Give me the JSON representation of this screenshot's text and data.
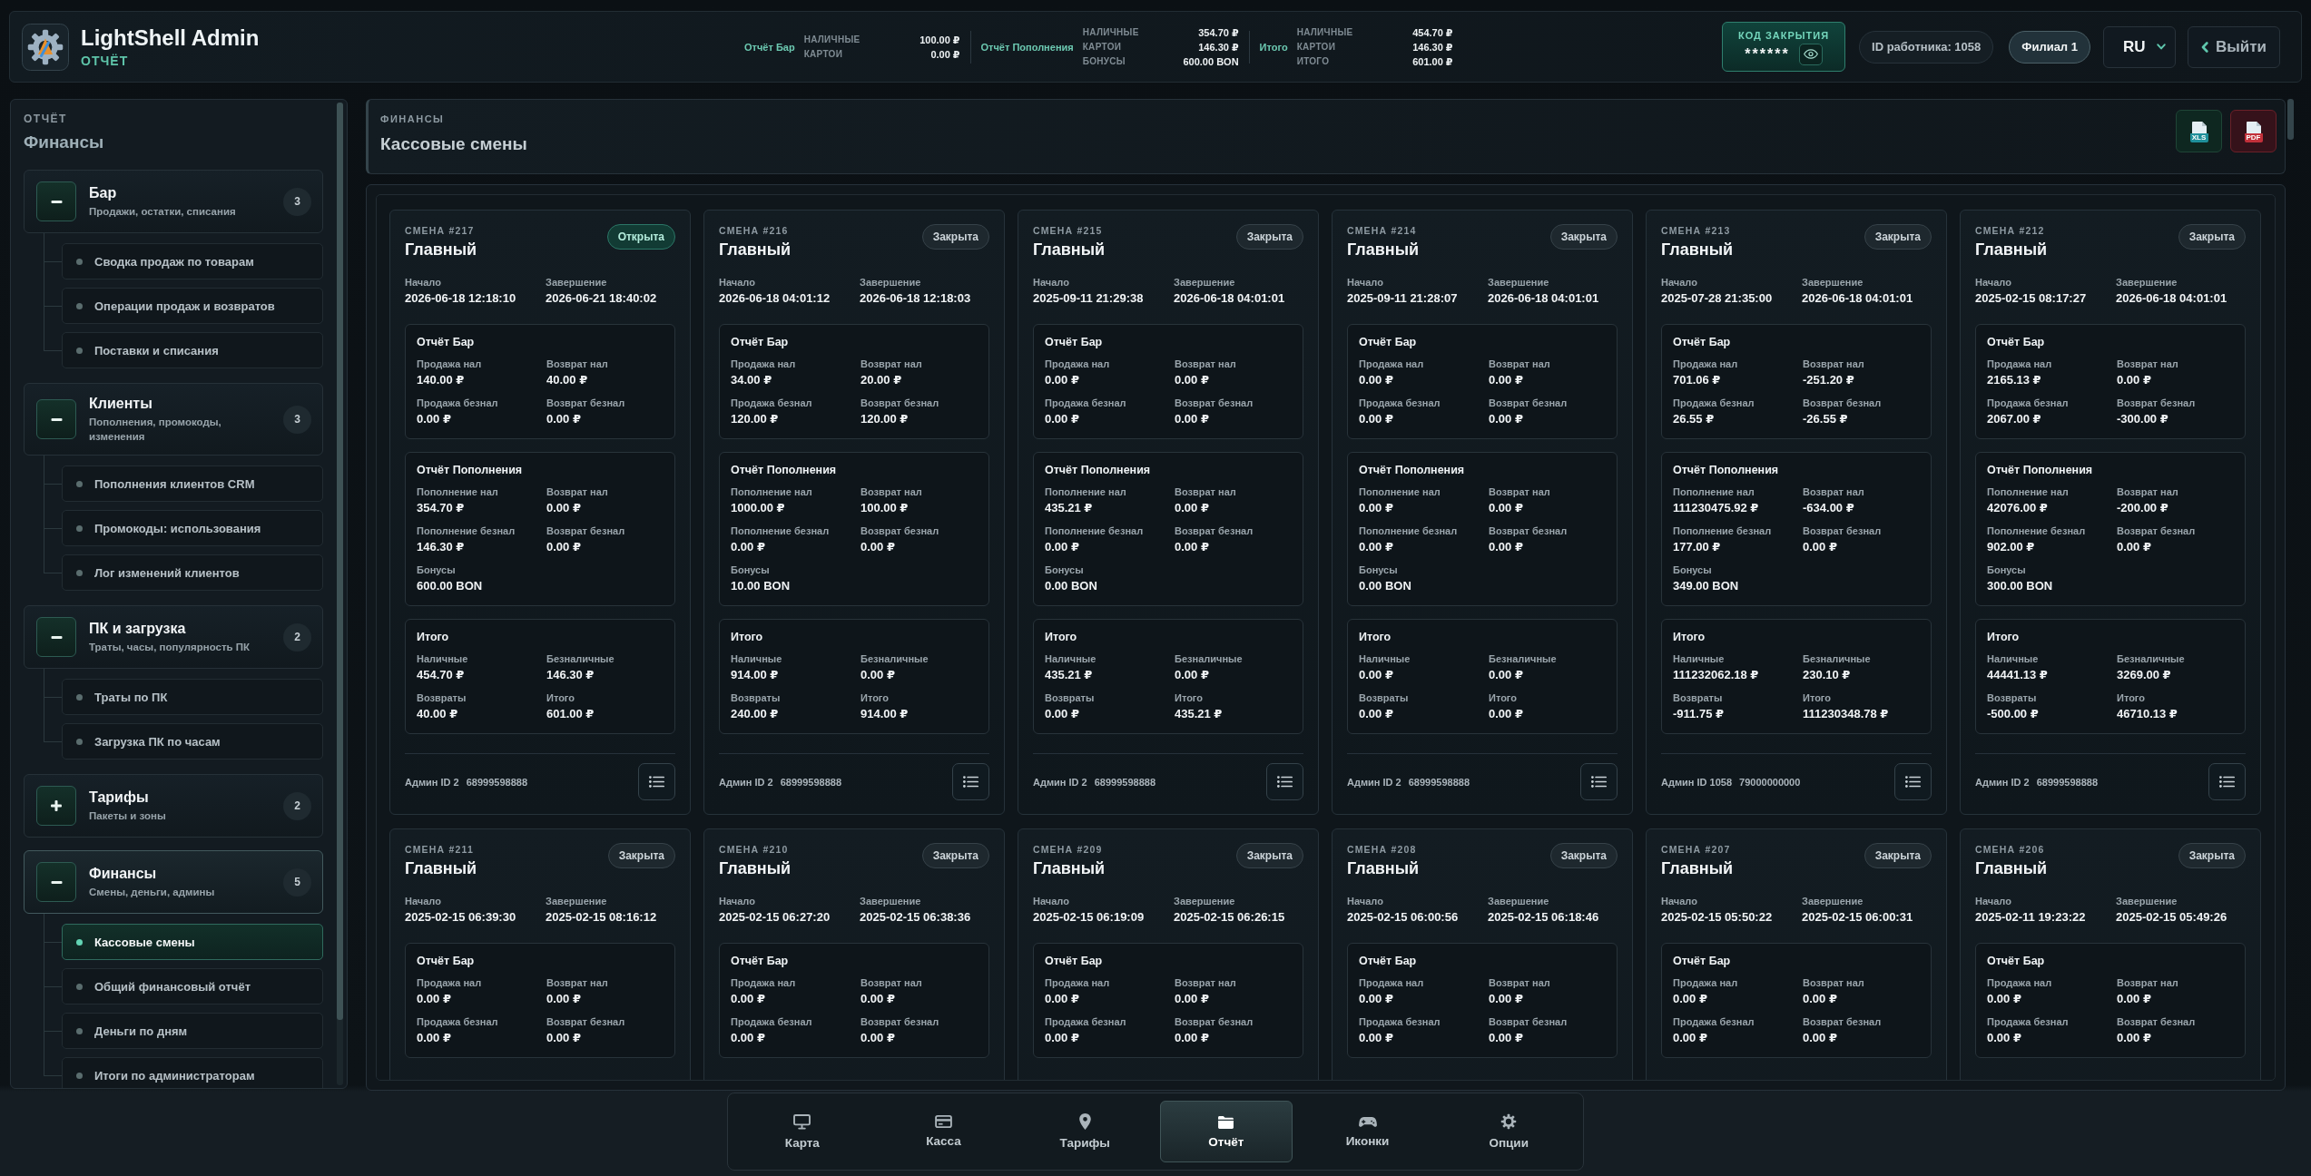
{
  "header": {
    "title": "LightShell Admin",
    "subtitle": "ОТЧЁТ",
    "summary": [
      {
        "title": "Отчёт Бар",
        "rows": [
          {
            "label": "НАЛИЧНЫЕ",
            "value": "100.00 ₽"
          },
          {
            "label": "КАРТОИ",
            "value": "0.00 ₽"
          }
        ]
      },
      {
        "title": "Отчёт Пополнения",
        "rows": [
          {
            "label": "НАЛИЧНЫЕ",
            "value": "354.70 ₽"
          },
          {
            "label": "КАРТОИ",
            "value": "146.30 ₽"
          },
          {
            "label": "БОНУСЫ",
            "value": "600.00 BON"
          }
        ]
      },
      {
        "title": "Итого",
        "rows": [
          {
            "label": "НАЛИЧНЫЕ",
            "value": "454.70 ₽"
          },
          {
            "label": "КАРТОИ",
            "value": "146.30 ₽"
          },
          {
            "label": "ИТОГО",
            "value": "601.00 ₽"
          }
        ]
      }
    ],
    "closing_code": {
      "label": "КОД ЗАКРЫТИЯ",
      "value": "******"
    },
    "employee": "ID работника: 1058",
    "branch": "Филиал 1",
    "language": "RU",
    "logout": "Выйти"
  },
  "sidebar": {
    "section": "ОТЧЁТ",
    "title": "Финансы",
    "groups": [
      {
        "title": "Бар",
        "subtitle": "Продажи, остатки, списания",
        "count": "3",
        "expanded": true,
        "selected": false,
        "children": [
          {
            "label": "Сводка продаж по товарам",
            "selected": false
          },
          {
            "label": "Операции продаж и возвратов",
            "selected": false
          },
          {
            "label": "Поставки и списания",
            "selected": false
          }
        ]
      },
      {
        "title": "Клиенты",
        "subtitle": "Пополнения, промокоды, изменения",
        "count": "3",
        "expanded": true,
        "selected": false,
        "children": [
          {
            "label": "Пополнения клиентов CRM",
            "selected": false
          },
          {
            "label": "Промокоды: использования",
            "selected": false
          },
          {
            "label": "Лог изменений клиентов",
            "selected": false
          }
        ]
      },
      {
        "title": "ПК и загрузка",
        "subtitle": "Траты, часы, популярность ПК",
        "count": "2",
        "expanded": true,
        "selected": false,
        "children": [
          {
            "label": "Траты по ПК",
            "selected": false
          },
          {
            "label": "Загрузка ПК по часам",
            "selected": false
          }
        ]
      },
      {
        "title": "Тарифы",
        "subtitle": "Пакеты и зоны",
        "count": "2",
        "expanded": false,
        "selected": false
      },
      {
        "title": "Финансы",
        "subtitle": "Смены, деньги, админы",
        "count": "5",
        "expanded": true,
        "selected": true,
        "children": [
          {
            "label": "Кассовые смены",
            "selected": true
          },
          {
            "label": "Общий финансовый отчёт",
            "selected": false
          },
          {
            "label": "Деньги по дням",
            "selected": false
          },
          {
            "label": "Итоги по администраторам",
            "selected": false
          }
        ]
      }
    ]
  },
  "page": {
    "section": "ФИНАНСЫ",
    "title": "Кассовые смены",
    "exports": [
      {
        "label": "XLS"
      },
      {
        "label": "PDF"
      }
    ]
  },
  "shifts": [
    {
      "number": "СМЕНА #217",
      "name": "Главный",
      "status": "Открыта",
      "open": true,
      "dates": [
        {
          "label": "Начало",
          "value": "2026-06-18 12:18:10"
        },
        {
          "label": "Завершение",
          "value": "2026-06-21 18:40:02"
        }
      ],
      "sections": [
        {
          "title": "Отчёт Бар",
          "fields": [
            {
              "label": "Продажа нал",
              "value": "140.00 ₽"
            },
            {
              "label": "Возврат нал",
              "value": "40.00 ₽"
            },
            {
              "label": "Продажа безнал",
              "value": "0.00 ₽"
            },
            {
              "label": "Возврат безнал",
              "value": "0.00 ₽"
            }
          ]
        },
        {
          "title": "Отчёт Пополнения",
          "fields": [
            {
              "label": "Пополнение нал",
              "value": "354.70 ₽"
            },
            {
              "label": "Возврат нал",
              "value": "0.00 ₽"
            },
            {
              "label": "Пополнение безнал",
              "value": "146.30 ₽"
            },
            {
              "label": "Возврат безнал",
              "value": "0.00 ₽"
            },
            {
              "label": "Бонусы",
              "value": "600.00 BON"
            }
          ]
        },
        {
          "title": "Итого",
          "fields": [
            {
              "label": "Наличные",
              "value": "454.70 ₽"
            },
            {
              "label": "Безналичные",
              "value": "146.30 ₽"
            },
            {
              "label": "Возвраты",
              "value": "40.00 ₽"
            },
            {
              "label": "Итого",
              "value": "601.00 ₽"
            }
          ]
        }
      ],
      "admin": "Админ ID 2",
      "phone": "68999598888"
    },
    {
      "number": "СМЕНА #216",
      "name": "Главный",
      "status": "Закрыта",
      "open": false,
      "dates": [
        {
          "label": "Начало",
          "value": "2026-06-18 04:01:12"
        },
        {
          "label": "Завершение",
          "value": "2026-06-18 12:18:03"
        }
      ],
      "sections": [
        {
          "title": "Отчёт Бар",
          "fields": [
            {
              "label": "Продажа нал",
              "value": "34.00 ₽"
            },
            {
              "label": "Возврат нал",
              "value": "20.00 ₽"
            },
            {
              "label": "Продажа безнал",
              "value": "120.00 ₽"
            },
            {
              "label": "Возврат безнал",
              "value": "120.00 ₽"
            }
          ]
        },
        {
          "title": "Отчёт Пополнения",
          "fields": [
            {
              "label": "Пополнение нал",
              "value": "1000.00 ₽"
            },
            {
              "label": "Возврат нал",
              "value": "100.00 ₽"
            },
            {
              "label": "Пополнение безнал",
              "value": "0.00 ₽"
            },
            {
              "label": "Возврат безнал",
              "value": "0.00 ₽"
            },
            {
              "label": "Бонусы",
              "value": "10.00 BON"
            }
          ]
        },
        {
          "title": "Итого",
          "fields": [
            {
              "label": "Наличные",
              "value": "914.00 ₽"
            },
            {
              "label": "Безналичные",
              "value": "0.00 ₽"
            },
            {
              "label": "Возвраты",
              "value": "240.00 ₽"
            },
            {
              "label": "Итого",
              "value": "914.00 ₽"
            }
          ]
        }
      ],
      "admin": "Админ ID 2",
      "phone": "68999598888"
    },
    {
      "number": "СМЕНА #215",
      "name": "Главный",
      "status": "Закрыта",
      "open": false,
      "dates": [
        {
          "label": "Начало",
          "value": "2025-09-11 21:29:38"
        },
        {
          "label": "Завершение",
          "value": "2026-06-18 04:01:01"
        }
      ],
      "sections": [
        {
          "title": "Отчёт Бар",
          "fields": [
            {
              "label": "Продажа нал",
              "value": "0.00 ₽"
            },
            {
              "label": "Возврат нал",
              "value": "0.00 ₽"
            },
            {
              "label": "Продажа безнал",
              "value": "0.00 ₽"
            },
            {
              "label": "Возврат безнал",
              "value": "0.00 ₽"
            }
          ]
        },
        {
          "title": "Отчёт Пополнения",
          "fields": [
            {
              "label": "Пополнение нал",
              "value": "435.21 ₽"
            },
            {
              "label": "Возврат нал",
              "value": "0.00 ₽"
            },
            {
              "label": "Пополнение безнал",
              "value": "0.00 ₽"
            },
            {
              "label": "Возврат безнал",
              "value": "0.00 ₽"
            },
            {
              "label": "Бонусы",
              "value": "0.00 BON"
            }
          ]
        },
        {
          "title": "Итого",
          "fields": [
            {
              "label": "Наличные",
              "value": "435.21 ₽"
            },
            {
              "label": "Безналичные",
              "value": "0.00 ₽"
            },
            {
              "label": "Возвраты",
              "value": "0.00 ₽"
            },
            {
              "label": "Итого",
              "value": "435.21 ₽"
            }
          ]
        }
      ],
      "admin": "Админ ID 2",
      "phone": "68999598888"
    },
    {
      "number": "СМЕНА #214",
      "name": "Главный",
      "status": "Закрыта",
      "open": false,
      "dates": [
        {
          "label": "Начало",
          "value": "2025-09-11 21:28:07"
        },
        {
          "label": "Завершение",
          "value": "2026-06-18 04:01:01"
        }
      ],
      "sections": [
        {
          "title": "Отчёт Бар",
          "fields": [
            {
              "label": "Продажа нал",
              "value": "0.00 ₽"
            },
            {
              "label": "Возврат нал",
              "value": "0.00 ₽"
            },
            {
              "label": "Продажа безнал",
              "value": "0.00 ₽"
            },
            {
              "label": "Возврат безнал",
              "value": "0.00 ₽"
            }
          ]
        },
        {
          "title": "Отчёт Пополнения",
          "fields": [
            {
              "label": "Пополнение нал",
              "value": "0.00 ₽"
            },
            {
              "label": "Возврат нал",
              "value": "0.00 ₽"
            },
            {
              "label": "Пополнение безнал",
              "value": "0.00 ₽"
            },
            {
              "label": "Возврат безнал",
              "value": "0.00 ₽"
            },
            {
              "label": "Бонусы",
              "value": "0.00 BON"
            }
          ]
        },
        {
          "title": "Итого",
          "fields": [
            {
              "label": "Наличные",
              "value": "0.00 ₽"
            },
            {
              "label": "Безналичные",
              "value": "0.00 ₽"
            },
            {
              "label": "Возвраты",
              "value": "0.00 ₽"
            },
            {
              "label": "Итого",
              "value": "0.00 ₽"
            }
          ]
        }
      ],
      "admin": "Админ ID 2",
      "phone": "68999598888"
    },
    {
      "number": "СМЕНА #213",
      "name": "Главный",
      "status": "Закрыта",
      "open": false,
      "dates": [
        {
          "label": "Начало",
          "value": "2025-07-28 21:35:00"
        },
        {
          "label": "Завершение",
          "value": "2026-06-18 04:01:01"
        }
      ],
      "sections": [
        {
          "title": "Отчёт Бар",
          "fields": [
            {
              "label": "Продажа нал",
              "value": "701.06 ₽"
            },
            {
              "label": "Возврат нал",
              "value": "-251.20 ₽"
            },
            {
              "label": "Продажа безнал",
              "value": "26.55 ₽"
            },
            {
              "label": "Возврат безнал",
              "value": "-26.55 ₽"
            }
          ]
        },
        {
          "title": "Отчёт Пополнения",
          "fields": [
            {
              "label": "Пополнение нал",
              "value": "111230475.92 ₽"
            },
            {
              "label": "Возврат нал",
              "value": "-634.00 ₽"
            },
            {
              "label": "Пополнение безнал",
              "value": "177.00 ₽"
            },
            {
              "label": "Возврат безнал",
              "value": "0.00 ₽"
            },
            {
              "label": "Бонусы",
              "value": "349.00 BON"
            }
          ]
        },
        {
          "title": "Итого",
          "fields": [
            {
              "label": "Наличные",
              "value": "111232062.18 ₽"
            },
            {
              "label": "Безналичные",
              "value": "230.10 ₽"
            },
            {
              "label": "Возвраты",
              "value": "-911.75 ₽"
            },
            {
              "label": "Итого",
              "value": "111230348.78 ₽"
            }
          ]
        }
      ],
      "admin": "Админ ID 1058",
      "phone": "79000000000"
    },
    {
      "number": "СМЕНА #212",
      "name": "Главный",
      "status": "Закрыта",
      "open": false,
      "dates": [
        {
          "label": "Начало",
          "value": "2025-02-15 08:17:27"
        },
        {
          "label": "Завершение",
          "value": "2026-06-18 04:01:01"
        }
      ],
      "sections": [
        {
          "title": "Отчёт Бар",
          "fields": [
            {
              "label": "Продажа нал",
              "value": "2165.13 ₽"
            },
            {
              "label": "Возврат нал",
              "value": "0.00 ₽"
            },
            {
              "label": "Продажа безнал",
              "value": "2067.00 ₽"
            },
            {
              "label": "Возврат безнал",
              "value": "-300.00 ₽"
            }
          ]
        },
        {
          "title": "Отчёт Пополнения",
          "fields": [
            {
              "label": "Пополнение нал",
              "value": "42076.00 ₽"
            },
            {
              "label": "Возврат нал",
              "value": "-200.00 ₽"
            },
            {
              "label": "Пополнение безнал",
              "value": "902.00 ₽"
            },
            {
              "label": "Возврат безнал",
              "value": "0.00 ₽"
            },
            {
              "label": "Бонусы",
              "value": "300.00 BON"
            }
          ]
        },
        {
          "title": "Итого",
          "fields": [
            {
              "label": "Наличные",
              "value": "44441.13 ₽"
            },
            {
              "label": "Безналичные",
              "value": "3269.00 ₽"
            },
            {
              "label": "Возвраты",
              "value": "-500.00 ₽"
            },
            {
              "label": "Итого",
              "value": "46710.13 ₽"
            }
          ]
        }
      ],
      "admin": "Админ ID 2",
      "phone": "68999598888"
    },
    {
      "number": "СМЕНА #211",
      "name": "Главный",
      "status": "Закрыта",
      "open": false,
      "dates": [
        {
          "label": "Начало",
          "value": "2025-02-15 06:39:30"
        },
        {
          "label": "Завершение",
          "value": "2025-02-15 08:16:12"
        }
      ],
      "sections": [
        {
          "title": "Отчёт Бар",
          "fields": [
            {
              "label": "Продажа нал",
              "value": "0.00 ₽"
            },
            {
              "label": "Возврат нал",
              "value": "0.00 ₽"
            },
            {
              "label": "Продажа безнал",
              "value": "0.00 ₽"
            },
            {
              "label": "Возврат безнал",
              "value": "0.00 ₽"
            }
          ]
        }
      ]
    },
    {
      "number": "СМЕНА #210",
      "name": "Главный",
      "status": "Закрыта",
      "open": false,
      "dates": [
        {
          "label": "Начало",
          "value": "2025-02-15 06:27:20"
        },
        {
          "label": "Завершение",
          "value": "2025-02-15 06:38:36"
        }
      ],
      "sections": [
        {
          "title": "Отчёт Бар",
          "fields": [
            {
              "label": "Продажа нал",
              "value": "0.00 ₽"
            },
            {
              "label": "Возврат нал",
              "value": "0.00 ₽"
            },
            {
              "label": "Продажа безнал",
              "value": "0.00 ₽"
            },
            {
              "label": "Возврат безнал",
              "value": "0.00 ₽"
            }
          ]
        }
      ]
    },
    {
      "number": "СМЕНА #209",
      "name": "Главный",
      "status": "Закрыта",
      "open": false,
      "dates": [
        {
          "label": "Начало",
          "value": "2025-02-15 06:19:09"
        },
        {
          "label": "Завершение",
          "value": "2025-02-15 06:26:15"
        }
      ],
      "sections": [
        {
          "title": "Отчёт Бар",
          "fields": [
            {
              "label": "Продажа нал",
              "value": "0.00 ₽"
            },
            {
              "label": "Возврат нал",
              "value": "0.00 ₽"
            },
            {
              "label": "Продажа безнал",
              "value": "0.00 ₽"
            },
            {
              "label": "Возврат безнал",
              "value": "0.00 ₽"
            }
          ]
        }
      ]
    },
    {
      "number": "СМЕНА #208",
      "name": "Главный",
      "status": "Закрыта",
      "open": false,
      "dates": [
        {
          "label": "Начало",
          "value": "2025-02-15 06:00:56"
        },
        {
          "label": "Завершение",
          "value": "2025-02-15 06:18:46"
        }
      ],
      "sections": [
        {
          "title": "Отчёт Бар",
          "fields": [
            {
              "label": "Продажа нал",
              "value": "0.00 ₽"
            },
            {
              "label": "Возврат нал",
              "value": "0.00 ₽"
            },
            {
              "label": "Продажа безнал",
              "value": "0.00 ₽"
            },
            {
              "label": "Возврат безнал",
              "value": "0.00 ₽"
            }
          ]
        }
      ]
    },
    {
      "number": "СМЕНА #207",
      "name": "Главный",
      "status": "Закрыта",
      "open": false,
      "dates": [
        {
          "label": "Начало",
          "value": "2025-02-15 05:50:22"
        },
        {
          "label": "Завершение",
          "value": "2025-02-15 06:00:31"
        }
      ],
      "sections": [
        {
          "title": "Отчёт Бар",
          "fields": [
            {
              "label": "Продажа нал",
              "value": "0.00 ₽"
            },
            {
              "label": "Возврат нал",
              "value": "0.00 ₽"
            },
            {
              "label": "Продажа безнал",
              "value": "0.00 ₽"
            },
            {
              "label": "Возврат безнал",
              "value": "0.00 ₽"
            }
          ]
        }
      ]
    },
    {
      "number": "СМЕНА #206",
      "name": "Главный",
      "status": "Закрыта",
      "open": false,
      "dates": [
        {
          "label": "Начало",
          "value": "2025-02-11 19:23:22"
        },
        {
          "label": "Завершение",
          "value": "2025-02-15 05:49:26"
        }
      ],
      "sections": [
        {
          "title": "Отчёт Бар",
          "fields": [
            {
              "label": "Продажа нал",
              "value": "0.00 ₽"
            },
            {
              "label": "Возврат нал",
              "value": "0.00 ₽"
            },
            {
              "label": "Продажа безнал",
              "value": "0.00 ₽"
            },
            {
              "label": "Возврат безнал",
              "value": "0.00 ₽"
            }
          ]
        }
      ]
    }
  ],
  "nav": [
    {
      "label": "Карта",
      "selected": false
    },
    {
      "label": "Касса",
      "selected": false
    },
    {
      "label": "Тарифы",
      "selected": false
    },
    {
      "label": "Отчёт",
      "selected": true
    },
    {
      "label": "Иконки",
      "selected": false
    },
    {
      "label": "Опции",
      "selected": false
    }
  ]
}
